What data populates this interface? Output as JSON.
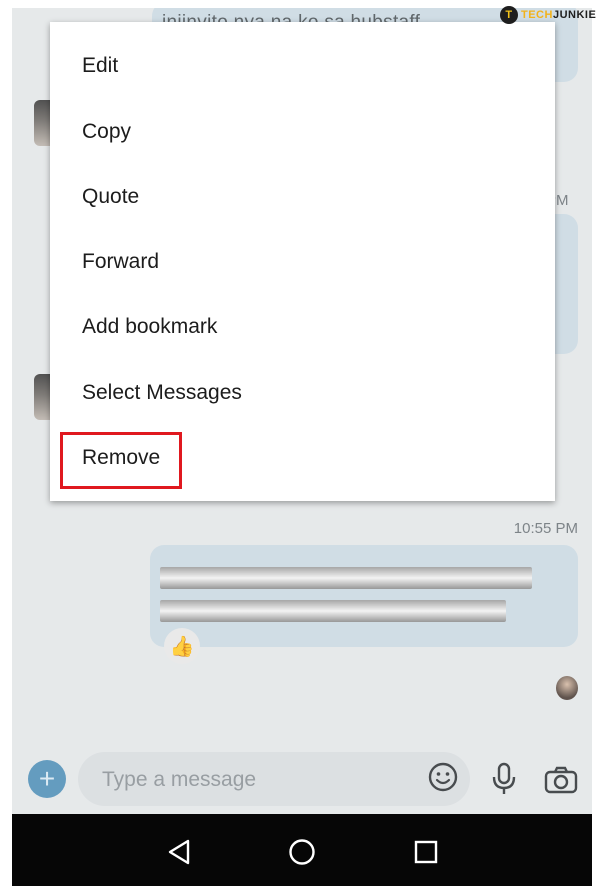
{
  "chat": {
    "top_message_partial": "injinvito nya na ko sa hubstaff",
    "partial_time": "PM",
    "last_message_time": "10:55 PM",
    "reaction": "👍"
  },
  "context_menu": {
    "items": [
      {
        "label": "Edit"
      },
      {
        "label": "Copy"
      },
      {
        "label": "Quote"
      },
      {
        "label": "Forward"
      },
      {
        "label": "Add bookmark"
      },
      {
        "label": "Select Messages"
      },
      {
        "label": "Remove"
      }
    ],
    "highlighted_item": "Remove",
    "highlight_color": "#e0181f"
  },
  "composer": {
    "placeholder": "Type a message",
    "add_label": "+",
    "accent_color": "#4f8fb7"
  },
  "watermark": {
    "logo_letter": "T",
    "part1": "TECH",
    "part2": "JUNKIE"
  },
  "icons": {
    "add": "plus-icon",
    "emoji": "emoji-icon",
    "mic": "microphone-icon",
    "camera": "camera-icon",
    "back": "back-triangle-icon",
    "home": "home-circle-icon",
    "recents": "recents-square-icon"
  }
}
